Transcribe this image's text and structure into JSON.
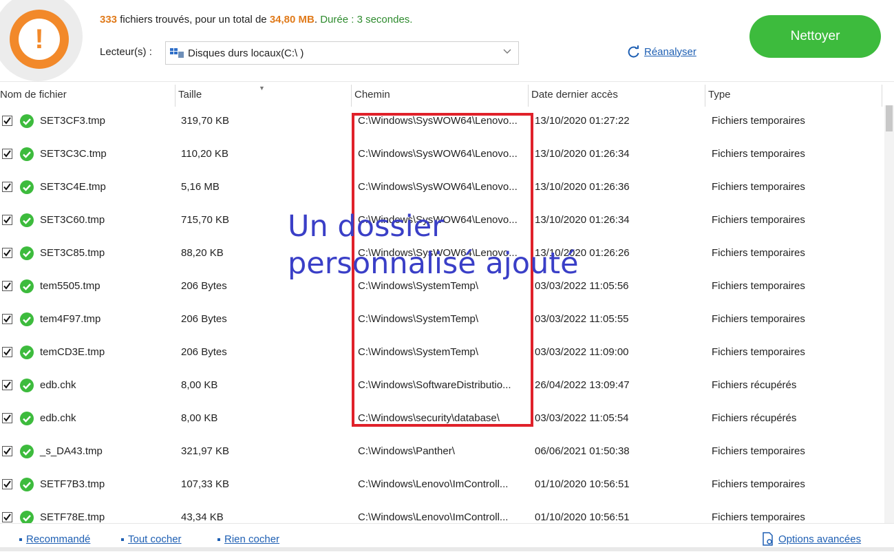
{
  "summary": {
    "count": "333",
    "count_text": "fichiers trouvés, pour un total de",
    "total_size": "34,80 MB",
    "separator": ".",
    "duration": "Durée : 3 secondes."
  },
  "drive": {
    "label": "Lecteur(s) :",
    "selected": "Disques durs locaux(C:\\ )"
  },
  "actions": {
    "reanalyser": "Réanalyser",
    "nettoyer": "Nettoyer"
  },
  "columns": {
    "name": "Nom de fichier",
    "size": "Taille",
    "path": "Chemin",
    "date": "Date dernier accès",
    "type": "Type"
  },
  "rows": [
    {
      "name": "SET3CF3.tmp",
      "size": "319,70 KB",
      "path": "C:\\Windows\\SysWOW64\\Lenovo...",
      "date": "13/10/2020 01:27:22",
      "type": "Fichiers temporaires"
    },
    {
      "name": "SET3C3C.tmp",
      "size": "110,20 KB",
      "path": "C:\\Windows\\SysWOW64\\Lenovo...",
      "date": "13/10/2020 01:26:34",
      "type": "Fichiers temporaires"
    },
    {
      "name": "SET3C4E.tmp",
      "size": "5,16 MB",
      "path": "C:\\Windows\\SysWOW64\\Lenovo...",
      "date": "13/10/2020 01:26:36",
      "type": "Fichiers temporaires"
    },
    {
      "name": "SET3C60.tmp",
      "size": "715,70 KB",
      "path": "C:\\Windows\\SysWOW64\\Lenovo...",
      "date": "13/10/2020 01:26:34",
      "type": "Fichiers temporaires"
    },
    {
      "name": "SET3C85.tmp",
      "size": "88,20 KB",
      "path": "C:\\Windows\\SysWOW64\\Lenovo...",
      "date": "13/10/2020 01:26:26",
      "type": "Fichiers temporaires"
    },
    {
      "name": "tem5505.tmp",
      "size": "206 Bytes",
      "path": "C:\\Windows\\SystemTemp\\",
      "date": "03/03/2022 11:05:56",
      "type": "Fichiers temporaires"
    },
    {
      "name": "tem4F97.tmp",
      "size": "206 Bytes",
      "path": "C:\\Windows\\SystemTemp\\",
      "date": "03/03/2022 11:05:55",
      "type": "Fichiers temporaires"
    },
    {
      "name": "temCD3E.tmp",
      "size": "206 Bytes",
      "path": "C:\\Windows\\SystemTemp\\",
      "date": "03/03/2022 11:09:00",
      "type": "Fichiers temporaires"
    },
    {
      "name": "edb.chk",
      "size": "8,00 KB",
      "path": "C:\\Windows\\SoftwareDistributio...",
      "date": "26/04/2022 13:09:47",
      "type": "Fichiers récupérés"
    },
    {
      "name": "edb.chk",
      "size": "8,00 KB",
      "path": "C:\\Windows\\security\\database\\",
      "date": "03/03/2022 11:05:54",
      "type": "Fichiers récupérés"
    },
    {
      "name": "_s_DA43.tmp",
      "size": "321,97 KB",
      "path": "C:\\Windows\\Panther\\",
      "date": "06/06/2021 01:50:38",
      "type": "Fichiers temporaires"
    },
    {
      "name": "SETF7B3.tmp",
      "size": "107,33 KB",
      "path": "C:\\Windows\\Lenovo\\ImControll...",
      "date": "01/10/2020 10:56:51",
      "type": "Fichiers temporaires"
    },
    {
      "name": "SETF78E.tmp",
      "size": "43,34 KB",
      "path": "C:\\Windows\\Lenovo\\ImControll...",
      "date": "01/10/2020 10:56:51",
      "type": "Fichiers temporaires"
    }
  ],
  "annotation": {
    "line1": "Un dossier",
    "line2": "personnalisé ajouté"
  },
  "footer": {
    "recommande": "Recommandé",
    "tout_cocher": "Tout cocher",
    "rien_cocher": "Rien cocher",
    "options": "Options avancées"
  },
  "colors": {
    "accent_green": "#3dbb3d",
    "warning_orange": "#f2892a",
    "link_blue": "#1e5fb3",
    "highlight_red": "#e0212a",
    "annotation_blue": "#3a3fc7"
  }
}
